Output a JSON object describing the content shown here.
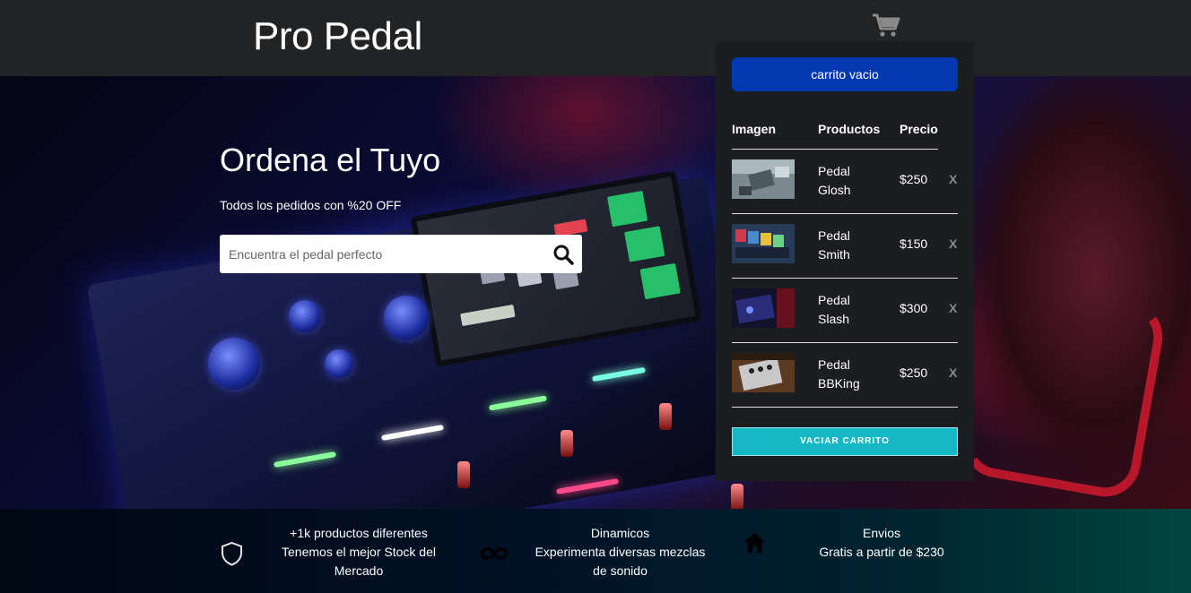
{
  "header": {
    "logo": "Pro Pedal",
    "cart_icon": "shopping-cart-icon"
  },
  "hero": {
    "title": "Ordena el Tuyo",
    "subtitle": "Todos los pedidos con %20 OFF",
    "search": {
      "placeholder": "Encuentra el pedal perfecto",
      "value": "",
      "icon": "search-icon"
    }
  },
  "cart": {
    "status": "carrito vacio",
    "columns": [
      "Imagen",
      "Productos",
      "Precio"
    ],
    "items": [
      {
        "name": "Pedal Glosh",
        "price": "$250",
        "remove": "X"
      },
      {
        "name": "Pedal Smith",
        "price": "$150",
        "remove": "X"
      },
      {
        "name": "Pedal Slash",
        "price": "$300",
        "remove": "X"
      },
      {
        "name": "Pedal BBKing",
        "price": "$250",
        "remove": "X"
      }
    ],
    "empty_button": "VACIAR CARRITO"
  },
  "features": [
    {
      "icon": "shield-icon",
      "title": "+1k productos diferentes",
      "text": "Tenemos el mejor Stock del Mercado"
    },
    {
      "icon": "infinity-icon",
      "title": "Dinamicos",
      "text": "Experimenta diversas mezclas de sonido"
    },
    {
      "icon": "home-icon",
      "title": "Envios",
      "text": "Gratis a partir de $230"
    }
  ],
  "colors": {
    "header_bg": "#212325",
    "cart_status_bg": "#0438b3",
    "empty_button_bg": "#13b8c2",
    "cart_panel_bg": "#1b1d20"
  }
}
